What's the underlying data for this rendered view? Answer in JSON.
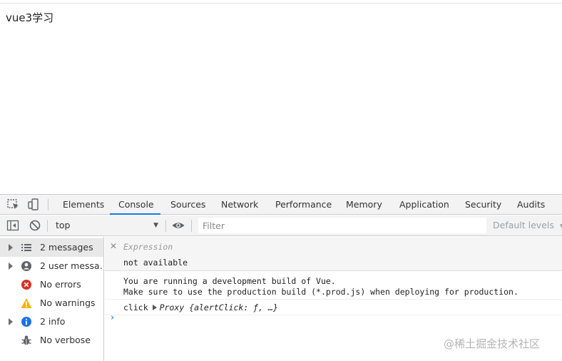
{
  "page": {
    "heading": "vue3学习"
  },
  "devtools": {
    "tabs": [
      {
        "label": "Elements"
      },
      {
        "label": "Console",
        "active": true
      },
      {
        "label": "Sources"
      },
      {
        "label": "Network"
      },
      {
        "label": "Performance"
      },
      {
        "label": "Memory"
      },
      {
        "label": "Application"
      },
      {
        "label": "Security"
      },
      {
        "label": "Audits"
      }
    ],
    "toolbar": {
      "context": "top",
      "filter_placeholder": "Filter",
      "levels": "Default levels"
    },
    "sidebar": {
      "items": [
        {
          "label": "2 messages",
          "icon": "list-icon",
          "expandable": true,
          "selected": true
        },
        {
          "label": "2 user messa…",
          "icon": "user-icon",
          "expandable": true
        },
        {
          "label": "No errors",
          "icon": "error-icon",
          "expandable": false
        },
        {
          "label": "No warnings",
          "icon": "warning-icon",
          "expandable": false
        },
        {
          "label": "2 info",
          "icon": "info-icon",
          "expandable": true
        },
        {
          "label": "No verbose",
          "icon": "bug-icon",
          "expandable": false
        }
      ]
    },
    "console": {
      "expression": {
        "label": "Expression",
        "value": "not available"
      },
      "messages": [
        {
          "line1": "You are running a development build of Vue.",
          "line2": "Make sure to use the production build (*.prod.js) when deploying for production."
        },
        {
          "prefix": "click",
          "object": "Proxy {alertClick: ƒ, …}"
        }
      ],
      "prompt": "›"
    }
  },
  "watermark": "@稀土掘金技术社区",
  "colors": {
    "accent": "#1a73e8",
    "error": "#d93025",
    "warning": "#f4b400",
    "info": "#1a73e8"
  }
}
